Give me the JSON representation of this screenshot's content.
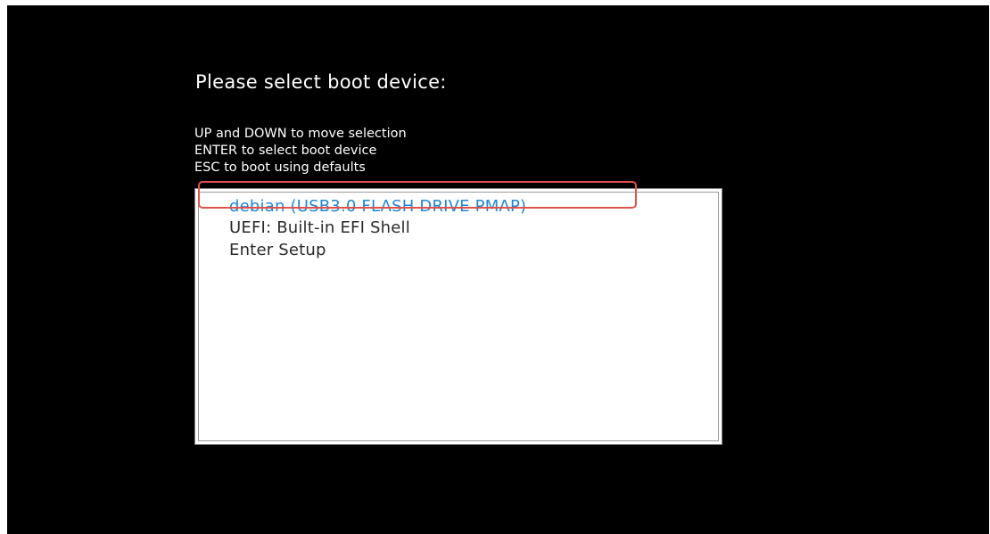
{
  "boot_menu": {
    "title": "Please select boot device:",
    "instructions": [
      "UP and DOWN to move selection",
      "ENTER to select boot device",
      "ESC to boot using defaults"
    ],
    "items": [
      {
        "label": "debian (USB3.0 FLASH DRIVE PMAP)",
        "selected": true
      },
      {
        "label": "UEFI: Built-in EFI Shell",
        "selected": false
      },
      {
        "label": "Enter Setup",
        "selected": false
      }
    ]
  },
  "colors": {
    "screen_background": "#000000",
    "text": "#ffffff",
    "menu_background": "#ffffff",
    "menu_text": "#2a2a2a",
    "selected_text": "#1f86d6",
    "highlight_outline": "#e0524b"
  }
}
